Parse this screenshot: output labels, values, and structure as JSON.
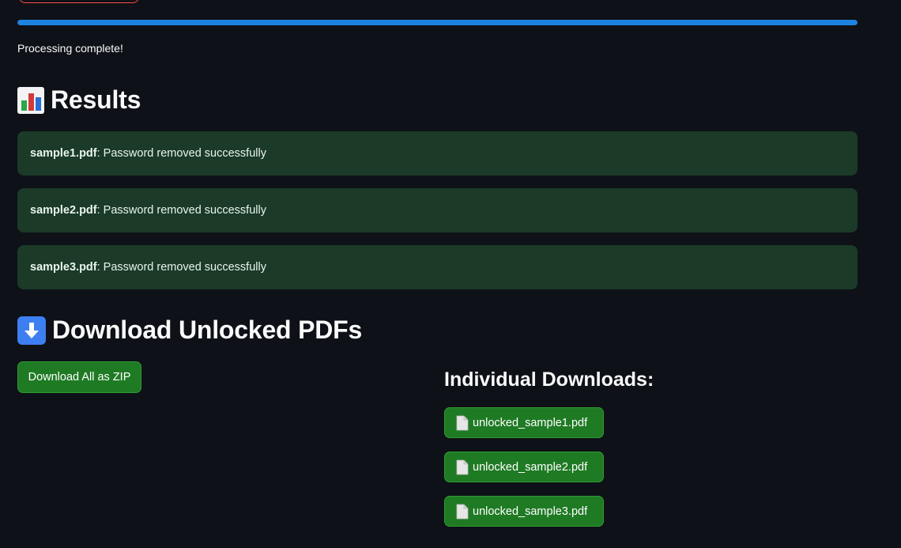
{
  "progress": {
    "fraction": 1.0,
    "color": "#1c83e1"
  },
  "status": {
    "text": "Processing complete!"
  },
  "results": {
    "title": "Results",
    "icon": "bar-chart-icon",
    "items": [
      {
        "filename": "sample1.pdf",
        "message": ": Password removed successfully"
      },
      {
        "filename": "sample2.pdf",
        "message": ": Password removed successfully"
      },
      {
        "filename": "sample3.pdf",
        "message": ": Password removed successfully"
      }
    ],
    "success_bg": "#1b3a28"
  },
  "download": {
    "title": "Download Unlocked PDFs",
    "icon": "down-arrow-icon",
    "zip_button_label": "Download All as ZIP",
    "individual_heading": "Individual Downloads:",
    "files": [
      {
        "label": "unlocked_sample1.pdf",
        "icon": "page-icon"
      },
      {
        "label": "unlocked_sample2.pdf",
        "icon": "page-icon"
      },
      {
        "label": "unlocked_sample3.pdf",
        "icon": "page-icon"
      }
    ],
    "button_color": "#1f7a24"
  }
}
